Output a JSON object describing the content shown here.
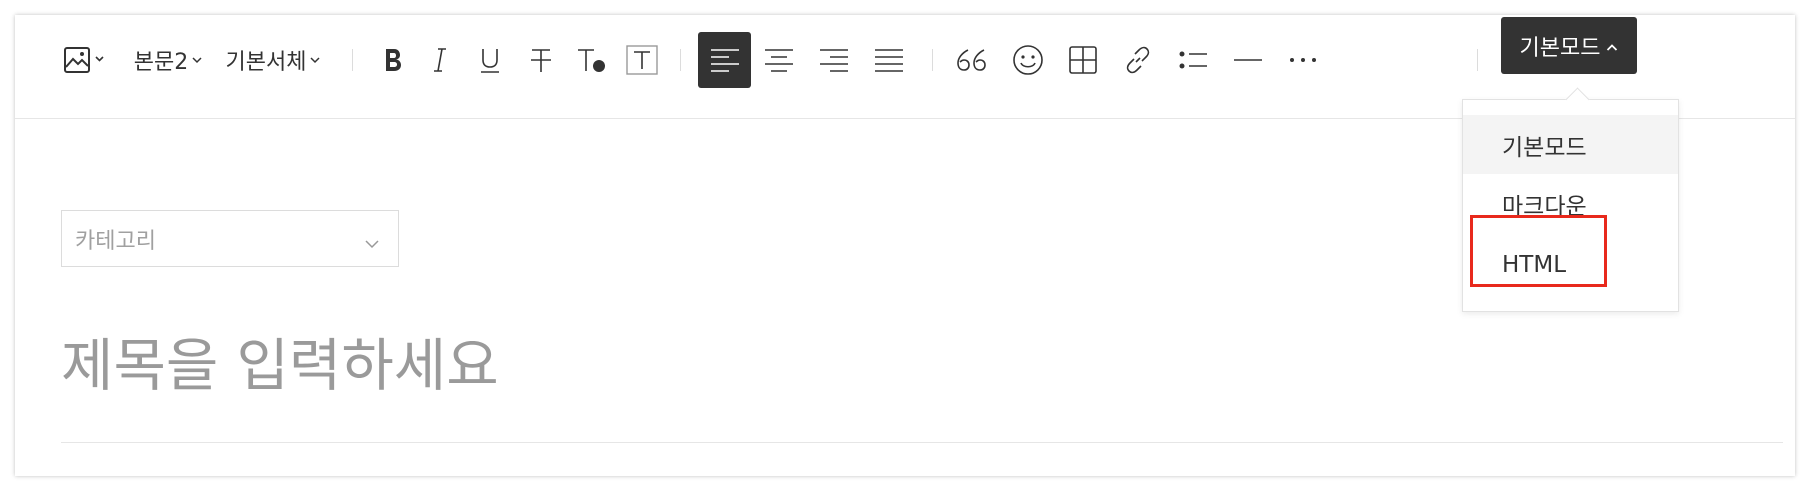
{
  "toolbar": {
    "image_icon": "image-icon",
    "paragraph_style": "본문2",
    "font_family": "기본서체",
    "buttons": [
      "bold",
      "italic",
      "underline",
      "strikethrough",
      "text-color",
      "text-background",
      "align-left",
      "align-center",
      "align-right",
      "align-justify",
      "quote",
      "emoticon",
      "table",
      "link",
      "list",
      "divider",
      "more"
    ],
    "active_button": "align-left",
    "mode_label": "기본모드"
  },
  "mode_menu": {
    "items": [
      "기본모드",
      "마크다운",
      "HTML"
    ],
    "hovered": "기본모드",
    "highlighted": "HTML",
    "highlight_color": "#e8291c"
  },
  "editor": {
    "category_placeholder": "카테고리",
    "title_placeholder": "제목을 입력하세요"
  },
  "colors": {
    "toolbar_active_bg": "#333333",
    "placeholder_text": "#9a9a9a"
  }
}
